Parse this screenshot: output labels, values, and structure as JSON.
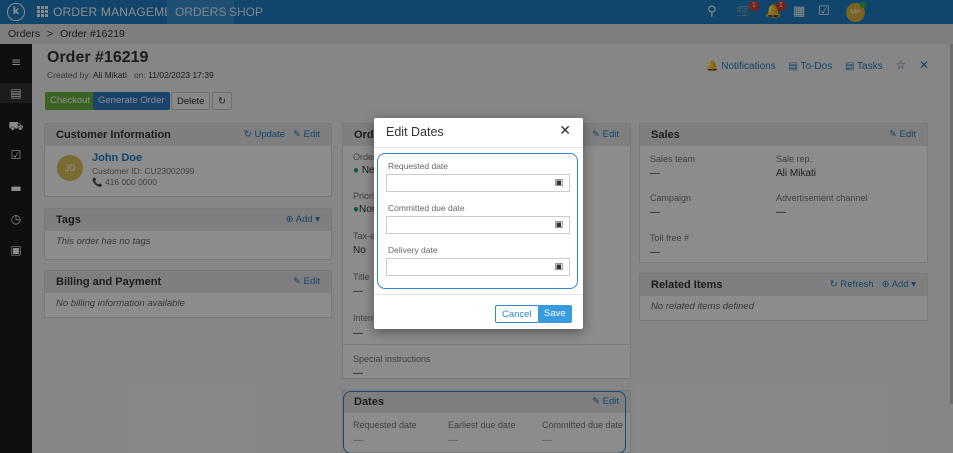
{
  "topbar": {
    "logo": "k",
    "app_title": "ORDER MANAGEMENT",
    "tabs": [
      "ORDERS",
      "SHOP"
    ],
    "cart_count": "1",
    "notif_count": "1",
    "user_initials": "MP"
  },
  "breadcrumb": {
    "root": "Orders",
    "separator": ">",
    "current": "Order #16219"
  },
  "order": {
    "title": "Order #16219",
    "created_label": "Created by:",
    "created_by": "Ali Mikati",
    "on_label": "on:",
    "created_on": "11/02/2023 17:39"
  },
  "header_actions": {
    "notifications": "Notifications",
    "todos": "To-Dos",
    "tasks": "Tasks"
  },
  "actions": {
    "checkout": "Checkout",
    "generate": "Generate Order",
    "delete": "Delete"
  },
  "customer": {
    "title": "Customer Information",
    "update": "Update",
    "edit": "Edit",
    "initials": "JD",
    "name": "John Doe",
    "id": "Customer ID: CU23002099",
    "phone": "416 000 0000"
  },
  "tags": {
    "title": "Tags",
    "add": "Add",
    "empty": "This order has no tags"
  },
  "billing": {
    "title": "Billing and Payment",
    "edit": "Edit",
    "empty": "No billing information available"
  },
  "order_panel": {
    "title": "Orde",
    "edit": "Edit",
    "order_label": "Order",
    "status": "Ne",
    "priority_label": "Priori",
    "priority": "Non",
    "tax_label": "Tax-e",
    "tax": "No",
    "title_label": "Title",
    "title_value": "—",
    "internal_label": "Intern",
    "internal_value": "—",
    "special_label": "Special instructions",
    "special_value": "—"
  },
  "dates": {
    "title": "Dates",
    "edit": "Edit",
    "requested": "Requested date",
    "earliest": "Earliest due date",
    "committed": "Committed due date",
    "requested_value": "—",
    "earliest_value": "—",
    "committed_value": "—"
  },
  "sales": {
    "title": "Sales",
    "edit": "Edit",
    "team_label": "Sales team",
    "team": "—",
    "rep_label": "Sale rep.",
    "rep": "Ali Mikati",
    "campaign_label": "Campaign",
    "campaign": "—",
    "adv_label": "Advertisement channel",
    "adv": "—",
    "tollfree_label": "Toll free #",
    "tollfree": "—"
  },
  "related": {
    "title": "Related Items",
    "refresh": "Refresh",
    "add": "Add",
    "empty": "No related items defined"
  },
  "modal": {
    "title": "Edit Dates",
    "requested_label": "Requested date",
    "committed_label": "Committed due date",
    "delivery_label": "Delivery date",
    "cancel": "Cancel",
    "save": "Save"
  }
}
